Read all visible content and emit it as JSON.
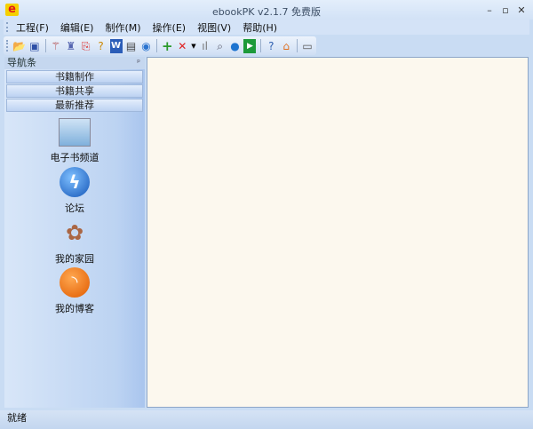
{
  "window": {
    "title": "ebookPK v2.1.7  免费版",
    "logo_letter": "e"
  },
  "menu": [
    "工程(F)",
    "编辑(E)",
    "制作(M)",
    "操作(E)",
    "视图(V)",
    "帮助(H)"
  ],
  "toolbar": [
    "open-folder",
    "save",
    "wand",
    "stamp",
    "pdf",
    "help-doc",
    "word",
    "document",
    "refresh",
    "add",
    "delete",
    "dropdown",
    "chart",
    "search",
    "chat",
    "play",
    "help",
    "home",
    "card"
  ],
  "nav": {
    "title": "导航条",
    "pin": "ᵖ",
    "buttons": [
      "书籍制作",
      "书籍共享",
      "最新推荐"
    ],
    "items": [
      {
        "label": "电子书频道",
        "icon": "ebook-channel"
      },
      {
        "label": "论坛",
        "icon": "forum"
      },
      {
        "label": "我的家园",
        "icon": "home-plant"
      },
      {
        "label": "我的博客",
        "icon": "rss-blog"
      }
    ]
  },
  "status": "就绪"
}
